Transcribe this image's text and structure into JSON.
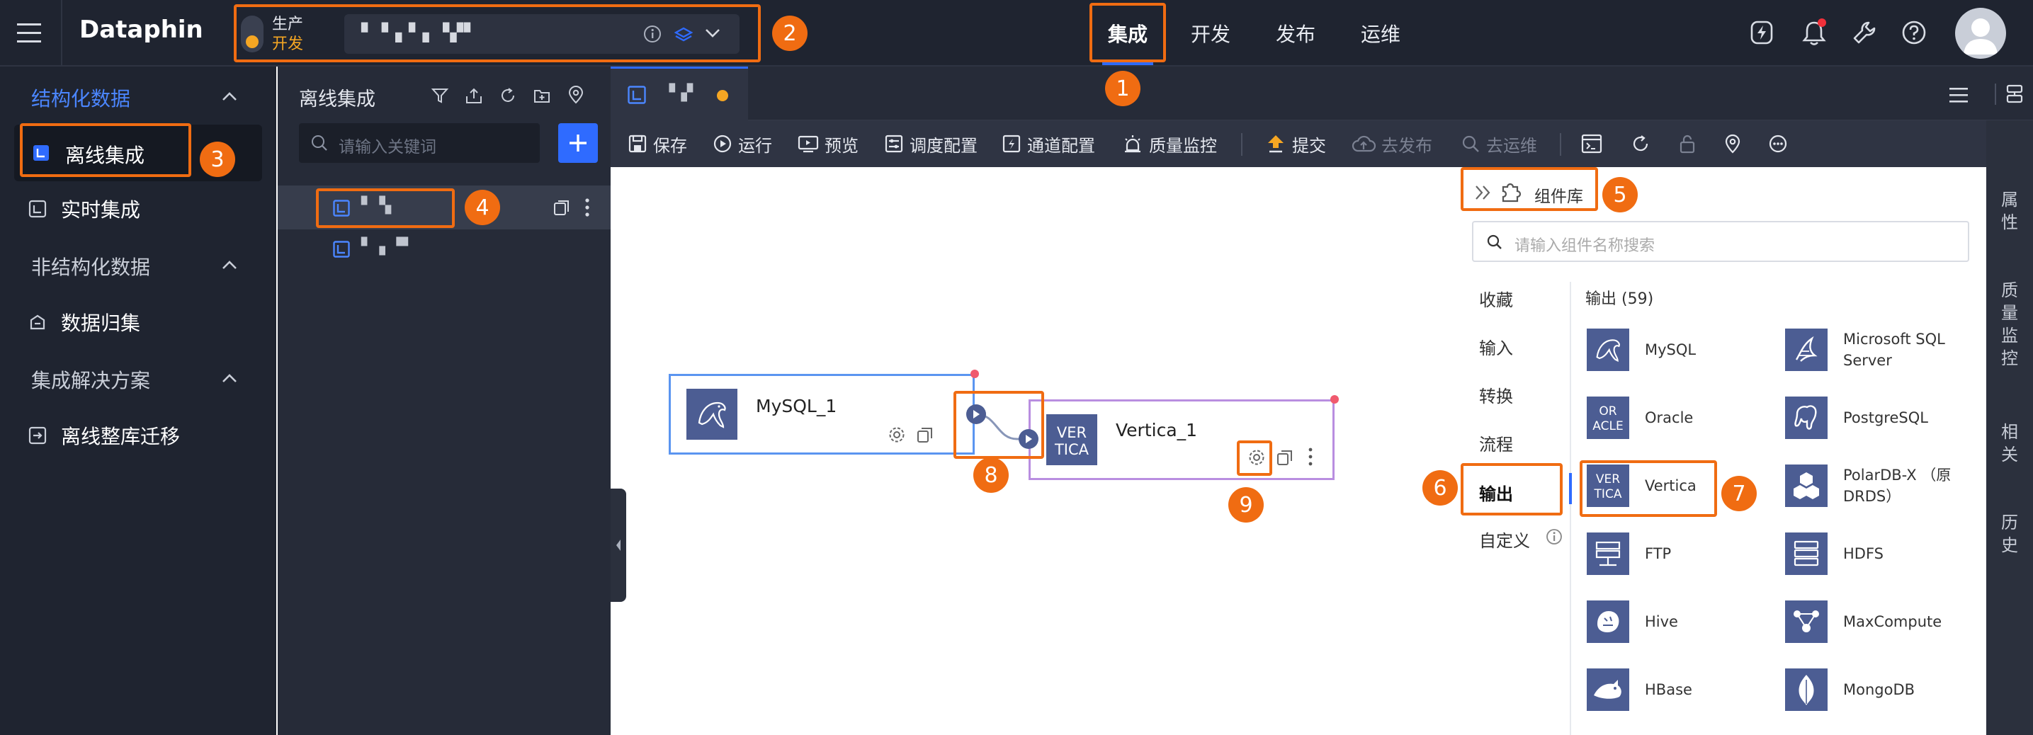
{
  "topbar": {
    "brand": "Dataphin",
    "env_top": "生产",
    "env_bottom": "开发",
    "project_name": "▘▝▗ ▘▖▝▞▘",
    "nav": [
      {
        "label": "集成",
        "active": true
      },
      {
        "label": "开发",
        "active": false
      },
      {
        "label": "发布",
        "active": false
      },
      {
        "label": "运维",
        "active": false
      }
    ]
  },
  "sidebar": {
    "sections": [
      {
        "title": "结构化数据",
        "items": [
          "离线集成",
          "实时集成"
        ]
      },
      {
        "title": "非结构化数据",
        "items": [
          "数据归集"
        ]
      },
      {
        "title": "集成解决方案",
        "items": [
          "离线整库迁移"
        ]
      }
    ]
  },
  "tree": {
    "title": "离线集成",
    "search_placeholder": "请输入关键词",
    "items": [
      "▘▝▖",
      "▘▗ ▝▘"
    ]
  },
  "editor": {
    "tab_label": "▝▗▘",
    "toolbar": {
      "save": "保存",
      "run": "运行",
      "preview": "预览",
      "schedule": "调度配置",
      "channel": "通道配置",
      "quality": "质量监控",
      "submit": "提交",
      "publish": "去发布",
      "ops": "去运维"
    },
    "nodes": [
      {
        "name": "MySQL_1",
        "icon": "mysql-icon"
      },
      {
        "name": "Vertica_1",
        "icon": "vertica-icon"
      }
    ]
  },
  "library": {
    "title": "组件库",
    "search_placeholder": "请输入组件名称搜索",
    "categories": [
      "收藏",
      "输入",
      "转换",
      "流程",
      "输出",
      "自定义"
    ],
    "active_category": "输出",
    "section_title": "输出 (59)",
    "components": [
      {
        "label": "MySQL",
        "icon": "mysql-icon"
      },
      {
        "label": "Microsoft SQL Server",
        "icon": "sqlserver-icon"
      },
      {
        "label": "Oracle",
        "icon": "oracle-icon"
      },
      {
        "label": "PostgreSQL",
        "icon": "postgresql-icon"
      },
      {
        "label": "Vertica",
        "icon": "vertica-icon"
      },
      {
        "label": "PolarDB-X （原DRDS）",
        "icon": "polardb-icon"
      },
      {
        "label": "FTP",
        "icon": "ftp-icon"
      },
      {
        "label": "HDFS",
        "icon": "hdfs-icon"
      },
      {
        "label": "Hive",
        "icon": "hive-icon"
      },
      {
        "label": "MaxCompute",
        "icon": "maxcompute-icon"
      },
      {
        "label": "HBase",
        "icon": "hbase-icon"
      },
      {
        "label": "MongoDB",
        "icon": "mongodb-icon"
      }
    ]
  },
  "right_side": [
    "属性",
    "质量监控",
    "相关",
    "历史"
  ],
  "annotations": [
    "1",
    "2",
    "3",
    "4",
    "5",
    "6",
    "7",
    "8",
    "9"
  ],
  "colors": {
    "accent": "#2f6bff",
    "annotation": "#f06c12",
    "icon_bg": "#4c5d93",
    "dark_bg": "#1f2430"
  }
}
